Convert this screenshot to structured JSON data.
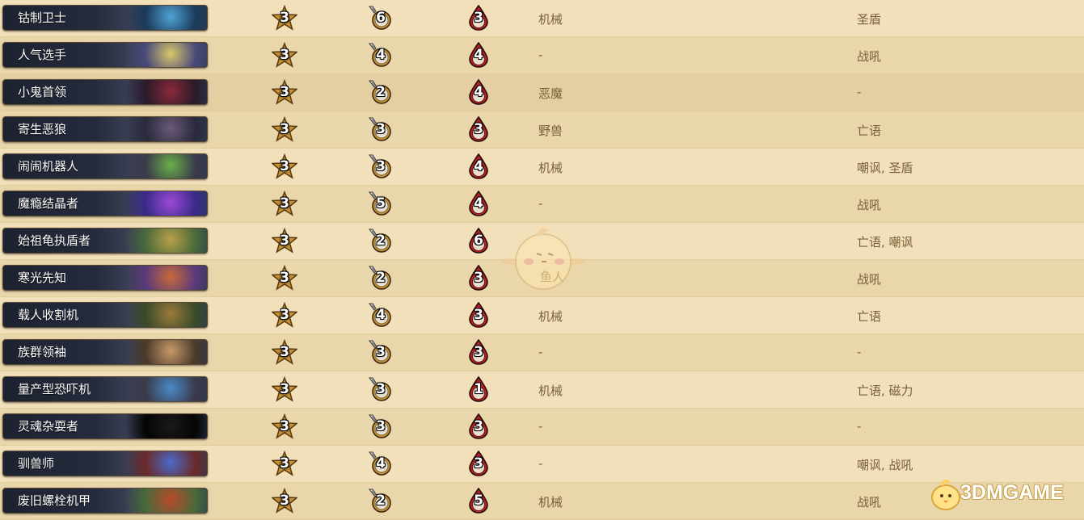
{
  "rows": [
    {
      "name": "钴制卫士",
      "tier": "3",
      "attack": "6",
      "health": "3",
      "tribe": "机械",
      "keywords": "圣盾",
      "art": [
        "#4fa3d6",
        "#1b3a5a"
      ]
    },
    {
      "name": "人气选手",
      "tier": "3",
      "attack": "4",
      "health": "4",
      "tribe": "-",
      "keywords": "战吼",
      "art": [
        "#d8c76a",
        "#4a4a7a"
      ]
    },
    {
      "name": "小鬼首领",
      "tier": "3",
      "attack": "2",
      "health": "4",
      "tribe": "恶魔",
      "keywords": "-",
      "art": [
        "#8a2a3a",
        "#2a1a2a"
      ]
    },
    {
      "name": "寄生恶狼",
      "tier": "3",
      "attack": "3",
      "health": "3",
      "tribe": "野兽",
      "keywords": "亡语",
      "art": [
        "#6a5a7a",
        "#2a2a3a"
      ]
    },
    {
      "name": "闹闹机器人",
      "tier": "3",
      "attack": "3",
      "health": "4",
      "tribe": "机械",
      "keywords": "嘲讽, 圣盾",
      "art": [
        "#6ab04a",
        "#3a3a4a"
      ]
    },
    {
      "name": "魔瘾结晶者",
      "tier": "3",
      "attack": "5",
      "health": "4",
      "tribe": "-",
      "keywords": "战吼",
      "art": [
        "#9a4ad6",
        "#3a2a8a"
      ]
    },
    {
      "name": "始祖龟执盾者",
      "tier": "3",
      "attack": "2",
      "health": "6",
      "tribe": "",
      "keywords": "亡语, 嘲讽",
      "art": [
        "#b8a04a",
        "#4a6a3a"
      ]
    },
    {
      "name": "寒光先知",
      "tier": "3",
      "attack": "2",
      "health": "3",
      "tribe": "",
      "keywords": "战吼",
      "art": [
        "#c86a3a",
        "#5a3a7a"
      ]
    },
    {
      "name": "载人收割机",
      "tier": "3",
      "attack": "4",
      "health": "3",
      "tribe": "机械",
      "keywords": "亡语",
      "art": [
        "#9a7a3a",
        "#3a4a2a"
      ]
    },
    {
      "name": "族群领袖",
      "tier": "3",
      "attack": "3",
      "health": "3",
      "tribe": "-",
      "keywords": "-",
      "art": [
        "#c89a6a",
        "#4a3a2a"
      ]
    },
    {
      "name": "量产型恐吓机",
      "tier": "3",
      "attack": "3",
      "health": "1",
      "tribe": "机械",
      "keywords": "亡语, 磁力",
      "art": [
        "#4a8ac8",
        "#3a3a4a"
      ]
    },
    {
      "name": "灵魂杂耍者",
      "tier": "3",
      "attack": "3",
      "health": "3",
      "tribe": "-",
      "keywords": "-",
      "art": [
        "#1a1a1a",
        "#050505"
      ]
    },
    {
      "name": "驯兽师",
      "tier": "3",
      "attack": "4",
      "health": "3",
      "tribe": "-",
      "keywords": "嘲讽, 战吼",
      "art": [
        "#4a6ac8",
        "#6a2a2a"
      ]
    },
    {
      "name": "废旧螺栓机甲",
      "tier": "3",
      "attack": "2",
      "health": "5",
      "tribe": "机械",
      "keywords": "战吼",
      "art": [
        "#b84a2a",
        "#4a6a3a"
      ]
    }
  ],
  "icons": {
    "tier": "star-icon",
    "attack": "sword-icon",
    "health": "blood-drop-icon"
  },
  "colors": {
    "background": "#efdcb2",
    "text": "#7a5f3b",
    "card_bg": "#1d2230",
    "health_drop": "#b32020",
    "tier_star": "#c9922f"
  },
  "watermark": {
    "center_text": "鱼人",
    "logo_text": "3DMGAME"
  }
}
